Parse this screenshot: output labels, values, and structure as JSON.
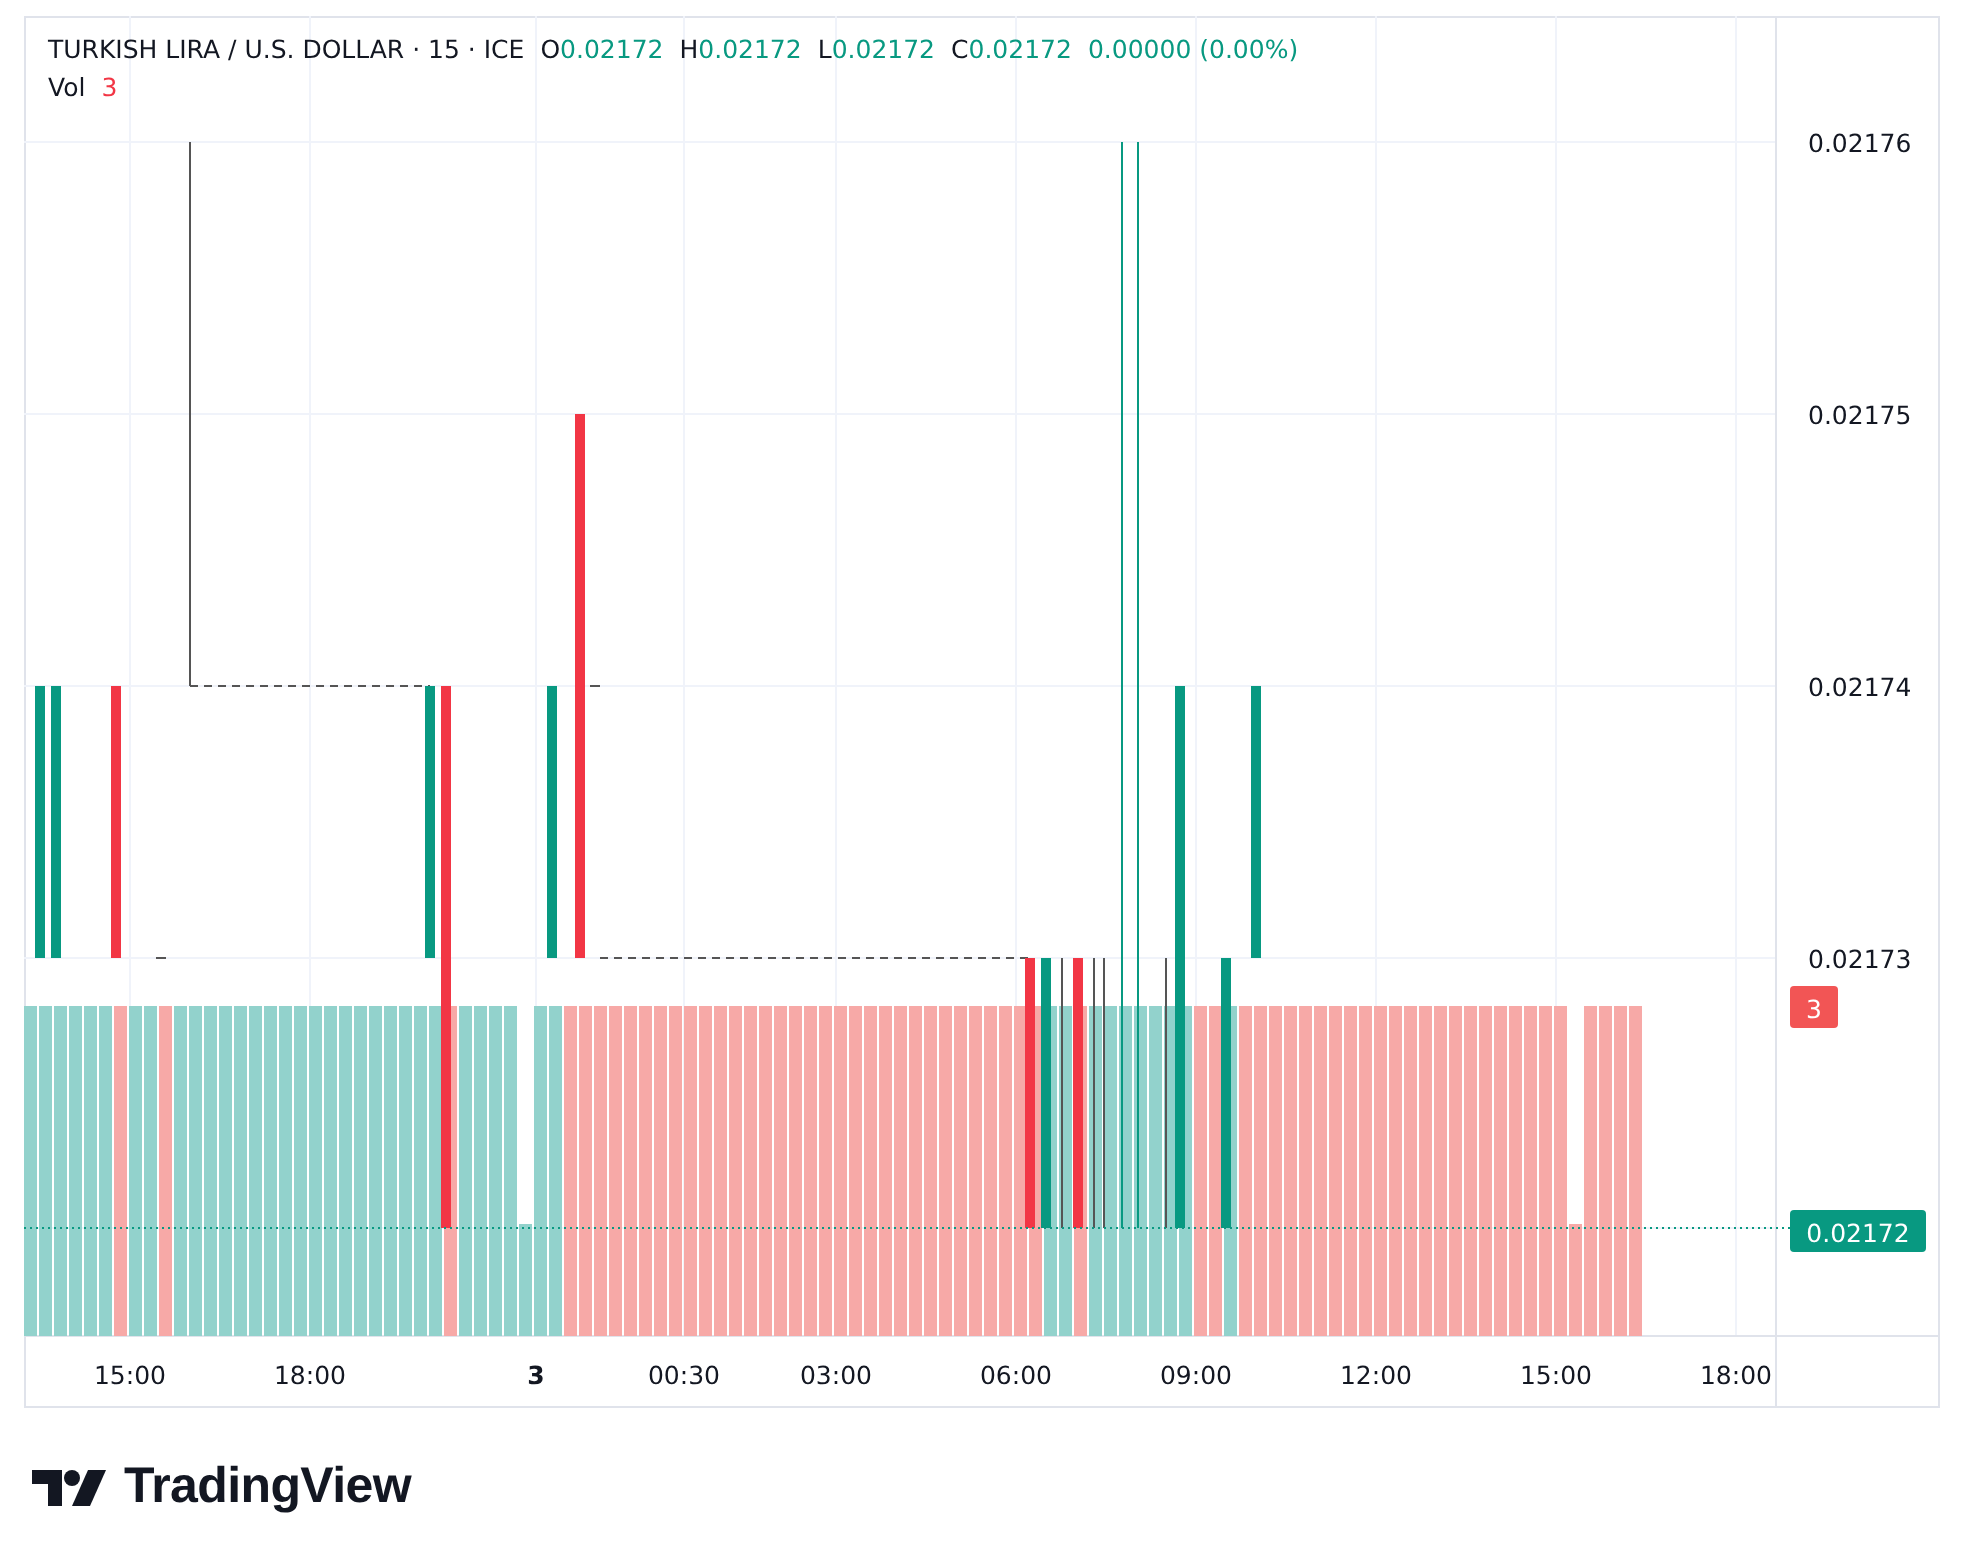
{
  "header": {
    "symbol": "TURKISH LIRA / U.S. DOLLAR · 15 · ICE",
    "ohlc": [
      {
        "label": "O",
        "value": "0.02172"
      },
      {
        "label": "H",
        "value": "0.02172"
      },
      {
        "label": "L",
        "value": "0.02172"
      },
      {
        "label": "C",
        "value": "0.02172"
      }
    ],
    "change": "0.00000 (0.00%)",
    "volume_label": "Vol",
    "volume_value": "3"
  },
  "price_axis": {
    "ticks": [
      "0.02176",
      "0.02175",
      "0.02174",
      "0.02173"
    ],
    "volume_badge": "3",
    "last_price_badge": "0.02172"
  },
  "time_axis": {
    "ticks": [
      {
        "label": "15:00",
        "kind": "time"
      },
      {
        "label": "18:00",
        "kind": "time"
      },
      {
        "label": "3",
        "kind": "day"
      },
      {
        "label": "00:30",
        "kind": "time"
      },
      {
        "label": "03:00",
        "kind": "time"
      },
      {
        "label": "06:00",
        "kind": "time"
      },
      {
        "label": "09:00",
        "kind": "time"
      },
      {
        "label": "12:00",
        "kind": "time"
      },
      {
        "label": "15:00",
        "kind": "time"
      },
      {
        "label": "18:00",
        "kind": "time"
      }
    ]
  },
  "brand": {
    "name": "TradingView"
  }
}
